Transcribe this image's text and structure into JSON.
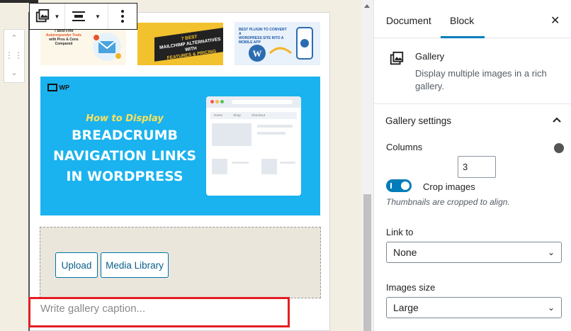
{
  "toolbar": {
    "gallery_icon": "gallery-icon",
    "align_icon": "align-icon",
    "more_icon": "more-vertical-icon"
  },
  "gallery": {
    "thumbnails": [
      {
        "lines": [
          "7 Best Free",
          "Autoresponder Tools",
          "with Pros & Cons Compared"
        ]
      },
      {
        "lines": [
          "7 BEST",
          "MAILCHIMP ALTERNATIVES WITH",
          "FEATURES & PRICING"
        ]
      },
      {
        "lines": [
          "BEST PLUGIN TO CONVERT A",
          "WORDPRESS SITE INTO A MOBILE APP"
        ]
      }
    ],
    "featured": {
      "brand": "WP",
      "subtitle": "How to Display",
      "title_lines": [
        "BREADCRUMB",
        "NAVIGATION LINKS",
        "IN WORDPRESS"
      ],
      "browser_tabs": [
        "Home",
        "Shop",
        "Checkout"
      ]
    },
    "upload_label": "Upload",
    "media_library_label": "Media Library",
    "caption_placeholder": "Write gallery caption..."
  },
  "sidebar": {
    "tabs": [
      "Document",
      "Block"
    ],
    "active_tab": "Block",
    "block": {
      "name": "Gallery",
      "description_lines": [
        "Display multiple images in a rich",
        "gallery."
      ]
    },
    "settings": {
      "title": "Gallery settings",
      "columns_label": "Columns",
      "columns_value": "3",
      "crop_label": "Crop images",
      "crop_enabled": true,
      "crop_help": "Thumbnails are cropped to align.",
      "link_to_label": "Link to",
      "link_to_value": "None",
      "images_size_label": "Images size",
      "images_size_value": "Large"
    }
  },
  "colors": {
    "accent": "#007cba",
    "highlight": "#e31e24",
    "featured_bg": "#1ab3ef"
  }
}
